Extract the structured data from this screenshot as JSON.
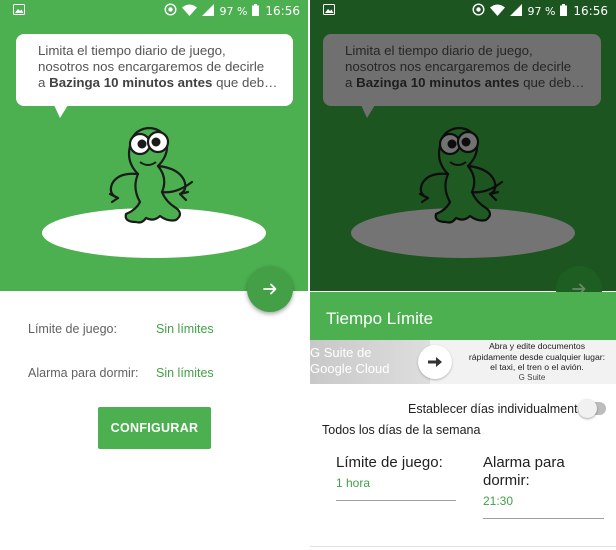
{
  "status": {
    "battery_text": "97 %",
    "time": "16:56"
  },
  "left": {
    "bubble": {
      "line1": "Limita el tiempo diario de juego,",
      "line2": "nosotros nos encargaremos de decirle",
      "line3_prefix": "a ",
      "line3_bold": "Bazinga 10 minutos antes",
      "line3_suffix": " que deb…"
    },
    "rows": [
      {
        "label": "Límite de juego:",
        "value": "Sin límites"
      },
      {
        "label": "Alarma para dormir:",
        "value": "Sin límites"
      }
    ],
    "configure_label": "CONFIGURAR"
  },
  "right": {
    "bubble": {
      "line1": "Limita el tiempo diario de juego,",
      "line2": "nosotros nos encargaremos de decirle",
      "line3_prefix": "a ",
      "line3_bold": "Bazinga 10 minutos antes",
      "line3_suffix": " que deb…"
    },
    "dialog_title": "Tiempo Límite",
    "ad": {
      "left_text_line1": "G Suite de",
      "left_text_line2": "Google Cloud",
      "text_line1": "Abra y edite documentos",
      "text_line2": "rápidamente desde cualquier lugar:",
      "text_line3": "el taxi, el tren o el avión.",
      "brand": "G Suite"
    },
    "toggle_label": "Establecer días individualmente",
    "toggle_on": false,
    "all_days_label": "Todos los días de la semana",
    "play_limit": {
      "label": "Límite de juego:",
      "value": "1 hora"
    },
    "sleep_alarm": {
      "label_line1": "Alarma para",
      "label_line2": "dormir:",
      "value": "21:30"
    }
  },
  "colors": {
    "accent_green": "#4caf50",
    "dark_green_overlay": "#1d5520",
    "value_green": "#43a047"
  },
  "icons": [
    "image-icon",
    "sync-icon",
    "wifi-icon",
    "signal-icon",
    "battery-icon",
    "arrow-right-icon",
    "mascot-icon"
  ]
}
